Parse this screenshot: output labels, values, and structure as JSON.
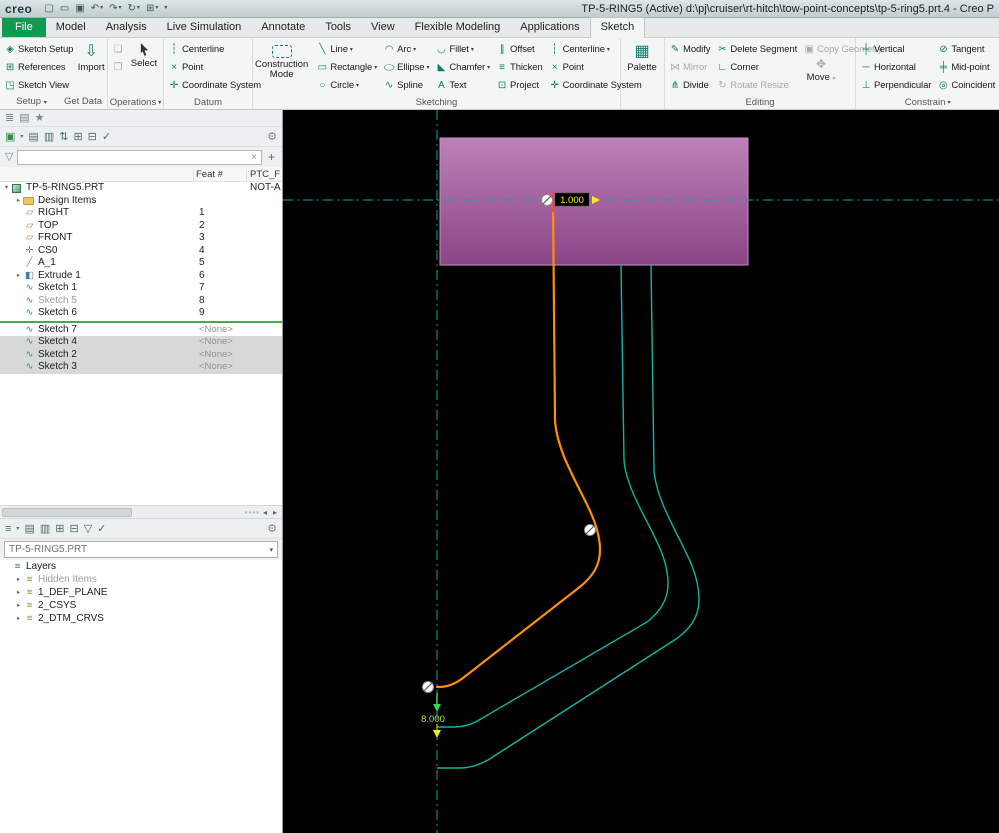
{
  "titlebar": {
    "logo": "creo",
    "title": "TP-5-RING5 (Active) d:\\pj\\cruiser\\rt-hitch\\tow-point-concepts\\tp-5-ring5.prt.4 - Creo P"
  },
  "tabs": [
    "File",
    "Model",
    "Analysis",
    "Live Simulation",
    "Annotate",
    "Tools",
    "View",
    "Flexible Modeling",
    "Applications",
    "Sketch"
  ],
  "ribbon": {
    "setup": {
      "sketch_setup": "Sketch Setup",
      "references": "References",
      "sketch_view": "Sketch View",
      "import_label": "Import",
      "group": "Setup",
      "get_data": "Get Data"
    },
    "operations": {
      "select": "Select",
      "group": "Operations"
    },
    "datum": {
      "centerline": "Centerline",
      "point": "Point",
      "csys": "Coordinate System",
      "group": "Datum"
    },
    "sketching": {
      "construction": "Construction Mode",
      "line": "Line",
      "rectangle": "Rectangle",
      "circle": "Circle",
      "arc": "Arc",
      "ellipse": "Ellipse",
      "spline": "Spline",
      "fillet": "Fillet",
      "chamfer": "Chamfer",
      "text": "Text",
      "offset": "Offset",
      "thicken": "Thicken",
      "project": "Project",
      "centerline": "Centerline",
      "point": "Point",
      "csys": "Coordinate System",
      "group": "Sketching"
    },
    "palette": {
      "label": "Palette"
    },
    "editing": {
      "modify": "Modify",
      "mirror": "Mirror",
      "divide": "Divide",
      "delete_segment": "Delete Segment",
      "corner": "Corner",
      "rotate_resize": "Rotate Resize",
      "copy_geometry": "Copy Geometry",
      "move": "Move",
      "group": "Editing"
    },
    "constrain": {
      "vertical": "Vertical",
      "horizontal": "Horizontal",
      "perpendicular": "Perpendicular",
      "tangent": "Tangent",
      "midpoint": "Mid-point",
      "coincident": "Coincident",
      "group": "Constrain"
    }
  },
  "model_tree": {
    "header_feat": "Feat #",
    "header_ptcf": "PTC_F",
    "rows": [
      {
        "label": "TP-5-RING5.PRT",
        "icon": "part",
        "arrow": "down",
        "feat": "",
        "status": "NOT-A",
        "ind": 0
      },
      {
        "label": "Design Items",
        "icon": "folder",
        "arrow": "right",
        "feat": "",
        "ind": 1
      },
      {
        "label": "RIGHT",
        "icon": "plane",
        "feat": "1",
        "ind": 1
      },
      {
        "label": "TOP",
        "icon": "plane",
        "feat": "2",
        "ind": 1
      },
      {
        "label": "FRONT",
        "icon": "plane",
        "feat": "3",
        "ind": 1
      },
      {
        "label": "CS0",
        "icon": "csys",
        "feat": "4",
        "ind": 1
      },
      {
        "label": "A_1",
        "icon": "axis",
        "feat": "5",
        "ind": 1
      },
      {
        "label": "Extrude 1",
        "icon": "extrude",
        "arrow": "right",
        "feat": "6",
        "ind": 1
      },
      {
        "label": "Sketch 1",
        "icon": "sketch",
        "feat": "7",
        "ind": 1
      },
      {
        "label": "Sketch 5",
        "icon": "sketch",
        "feat": "8",
        "ind": 1,
        "muted": true
      },
      {
        "label": "Sketch 6",
        "icon": "sketch",
        "feat": "9",
        "ind": 1
      },
      {
        "separator": true
      },
      {
        "label": "Sketch 7",
        "icon": "sketch",
        "feat": "<None>",
        "ind": 1
      },
      {
        "label": "Sketch 4",
        "icon": "sketch",
        "feat": "<None>",
        "ind": 1,
        "selected": true
      },
      {
        "label": "Sketch 2",
        "icon": "sketch",
        "feat": "<None>",
        "ind": 1,
        "selected": true
      },
      {
        "label": "Sketch 3",
        "icon": "sketch",
        "feat": "<None>",
        "ind": 1,
        "selected": true
      }
    ]
  },
  "layers_panel": {
    "combo_value": "TP-5-RING5.PRT",
    "items": [
      {
        "label": "Layers",
        "icon": "layers",
        "ind": 0
      },
      {
        "label": "Hidden Items",
        "icon": "layer",
        "arrow": "right",
        "ind": 1,
        "muted": true
      },
      {
        "label": "1_DEF_PLANE",
        "icon": "layer",
        "arrow": "right",
        "ind": 1
      },
      {
        "label": "2_CSYS",
        "icon": "layer",
        "arrow": "right",
        "ind": 1
      },
      {
        "label": "2_DTM_CRVS",
        "icon": "layer",
        "arrow": "right",
        "ind": 1
      }
    ]
  },
  "canvas": {
    "dim1": "1.000",
    "dim2": "8.000",
    "colors": {
      "entity": "#ff8e0a",
      "offset": "#16b2a4",
      "centerline": "#0ca69a",
      "preview_top": "#bd80b8",
      "preview_bottom": "#8a4587",
      "dim_text": "#f2ed13",
      "dim2_text": "#c8dc3c"
    }
  },
  "icons": {
    "chevron-down": "▾",
    "funnel": "▽",
    "clear": "×",
    "add": "+",
    "scroll-left": "◂",
    "scroll-right": "▸",
    "expand": "▸",
    "collapse": "▾",
    "new-doc": "▢",
    "open": "▭",
    "save": "▣",
    "undo": "↶",
    "redo": "↷",
    "regenerate": "↻",
    "window": "⊞",
    "sketch-setup": "◈",
    "references": "⊞",
    "sketch-view": "◳",
    "import": "⇩",
    "copy": "❏",
    "paste": "❐",
    "centerline": "┆",
    "point": "×",
    "csys": "✛",
    "line": "╲",
    "rectangle": "▭",
    "circle": "○",
    "arc": "◠",
    "ellipse": "◯",
    "spline": "∿",
    "fillet": "◡",
    "chamfer": "◣",
    "text": "A",
    "offset": "∥",
    "thicken": "≡",
    "project": "⊡",
    "palette": "▦",
    "modify": "✎",
    "mirror": "⋈",
    "divide": "⋔",
    "delete-segment": "✂",
    "corner": "∟",
    "rotate-resize": "↻",
    "copy-geometry": "▣",
    "move": "✥",
    "vertical": "┼",
    "horizontal": "─",
    "perpendicular": "⊥",
    "tangent": "⊘",
    "midpoint": "╪",
    "coincident": "◎",
    "nav-tree": "≣",
    "nav-folder": "▤",
    "nav-fav": "★",
    "settings": "⚙",
    "cube": "▣",
    "list1": "▤",
    "list2": "▥",
    "updown": "⇅",
    "exp": "⊞",
    "col": "⊟",
    "check": "✓"
  },
  "tree_icons": {
    "part": "",
    "folder": "",
    "plane": "▱",
    "csys": "✛",
    "axis": "╱",
    "extrude": "◧",
    "sketch": "∿",
    "layer": "≡",
    "layers": "≡"
  }
}
